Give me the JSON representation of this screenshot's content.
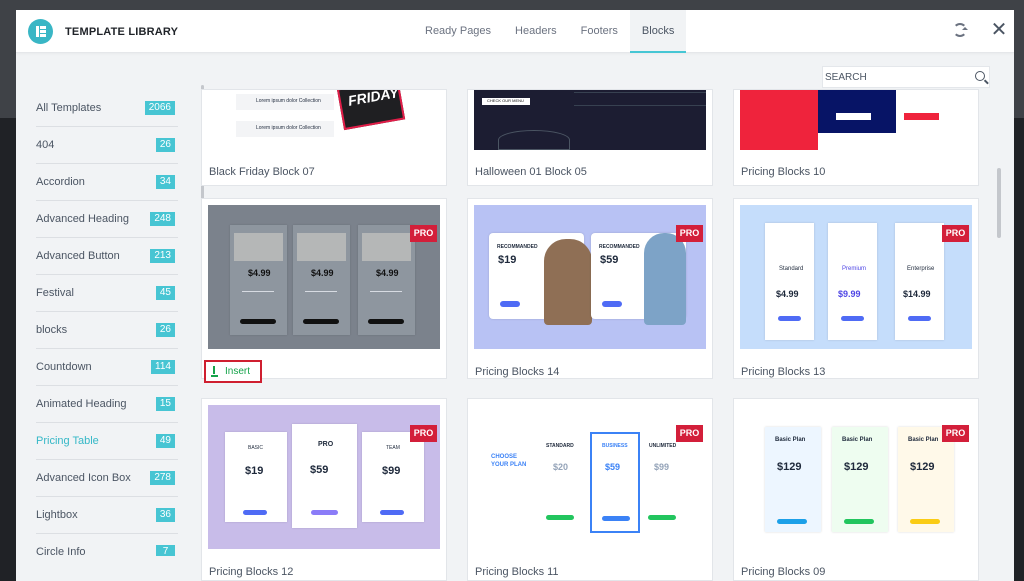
{
  "app": {
    "title": "TEMPLATE LIBRARY",
    "logo_icon": "elementor-logo"
  },
  "tabs": [
    {
      "label": "Ready Pages",
      "active": false
    },
    {
      "label": "Headers",
      "active": false
    },
    {
      "label": "Footers",
      "active": false
    },
    {
      "label": "Blocks",
      "active": true
    }
  ],
  "actions": {
    "refresh_icon": "refresh-icon",
    "close_label": "✕"
  },
  "search": {
    "placeholder": "SEARCH",
    "icon": "search-icon"
  },
  "sidebar": {
    "items": [
      {
        "label": "All Templates",
        "count": "2066",
        "active": false
      },
      {
        "label": "404",
        "count": "26",
        "active": false
      },
      {
        "label": "Accordion",
        "count": "34",
        "active": false
      },
      {
        "label": "Advanced Heading",
        "count": "248",
        "active": false
      },
      {
        "label": "Advanced Button",
        "count": "213",
        "active": false
      },
      {
        "label": "Festival",
        "count": "45",
        "active": false
      },
      {
        "label": "blocks",
        "count": "26",
        "active": false
      },
      {
        "label": "Countdown",
        "count": "114",
        "active": false
      },
      {
        "label": "Animated Heading",
        "count": "15",
        "active": false
      },
      {
        "label": "Pricing Table",
        "count": "49",
        "active": true
      },
      {
        "label": "Advanced Icon Box",
        "count": "278",
        "active": false
      },
      {
        "label": "Lightbox",
        "count": "36",
        "active": false
      },
      {
        "label": "Circle Info",
        "count": "7",
        "active": false
      }
    ]
  },
  "templates": {
    "row1": [
      {
        "title": "Black Friday Block 07",
        "thumb_text": "FRIDAY",
        "items": [
          "Lorem ipsum dolor Collection",
          "Lorem ipsum dolor Collection"
        ]
      },
      {
        "title": "Halloween 01 Block 05",
        "thumb_text": "CHECK OUR MENU"
      },
      {
        "title": "Pricing Blocks 10"
      }
    ],
    "row2": [
      {
        "title": "",
        "pro": "PRO",
        "insert_label": "Insert",
        "prices": [
          "$4.99",
          "$4.99",
          "$4.99"
        ]
      },
      {
        "title": "Pricing Blocks 14",
        "pro": "PRO",
        "tags": [
          "RECOMMANDED",
          "RECOMMANDED"
        ],
        "prices": [
          "$19",
          "$59"
        ]
      },
      {
        "title": "Pricing Blocks 13",
        "pro": "PRO",
        "plans": [
          "Standard",
          "Premium",
          "Enterprise"
        ],
        "prices": [
          "$4.99",
          "$9.99",
          "$14.99"
        ]
      }
    ],
    "row3": [
      {
        "title": "Pricing Blocks 12",
        "pro": "PRO",
        "plans": [
          "BASIC",
          "PRO",
          "TEAM"
        ],
        "prices": [
          "$19",
          "$59",
          "$99"
        ]
      },
      {
        "title": "Pricing Blocks 11",
        "pro": "PRO",
        "heading": "CHOOSE YOUR PLAN",
        "plans": [
          "STANDARD",
          "BUSINESS",
          "UNLIMITED"
        ],
        "prices": [
          "$20",
          "$59",
          "$99"
        ]
      },
      {
        "title": "Pricing Blocks 09",
        "pro": "PRO",
        "plans": [
          "Basic Plan",
          "Basic Plan",
          "Basic Plan"
        ],
        "prices": [
          "$129",
          "$129",
          "$129"
        ]
      }
    ]
  },
  "colors": {
    "accent": "#47c5d3",
    "pro": "#d31f3a",
    "insert_outline": "#cf1f30"
  }
}
